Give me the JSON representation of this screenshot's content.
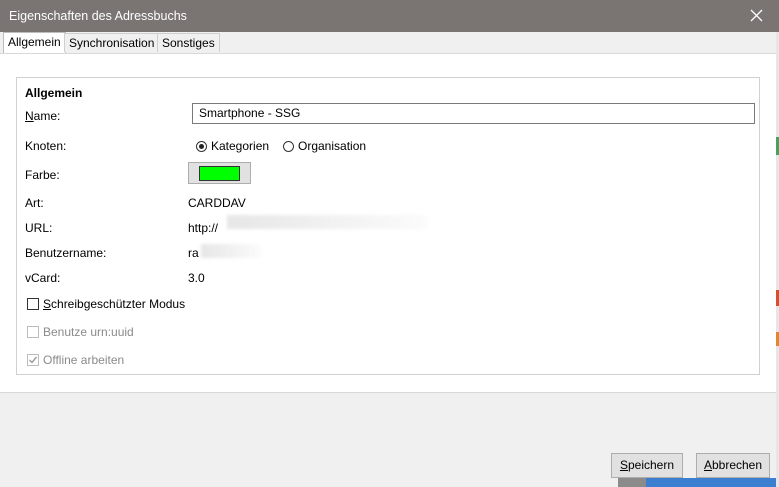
{
  "window": {
    "title": "Eigenschaften des Adressbuchs"
  },
  "tabs": [
    {
      "label": "Allgemein",
      "active": true
    },
    {
      "label": "Synchronisation",
      "active": false
    },
    {
      "label": "Sonstiges",
      "active": false
    }
  ],
  "group": {
    "title": "Allgemein",
    "name": {
      "label_accel": "N",
      "label_rest": "ame:",
      "value": "Smartphone - SSG"
    },
    "knoten": {
      "label": "Knoten:",
      "options": [
        {
          "label": "Kategorien",
          "selected": true
        },
        {
          "label": "Organisation",
          "selected": false
        }
      ]
    },
    "farbe": {
      "label": "Farbe:",
      "color": "#00ff00"
    },
    "art": {
      "label": "Art:",
      "value": "CARDDAV"
    },
    "url": {
      "label": "URL:",
      "value": "http://"
    },
    "benutzername": {
      "label": "Benutzername:",
      "value": "ra"
    },
    "vcard": {
      "label": "vCard:",
      "value": "3.0"
    },
    "checkboxes": [
      {
        "accel": "S",
        "rest": "chreibgeschützter Modus",
        "checked": false,
        "enabled": true
      },
      {
        "accel": "",
        "rest": "Benutze urn:uuid",
        "checked": false,
        "enabled": false
      },
      {
        "accel": "",
        "rest": "Offline arbeiten",
        "checked": true,
        "enabled": false
      }
    ]
  },
  "buttons": {
    "save_accel": "S",
    "save_rest": "peichern",
    "cancel_accel": "A",
    "cancel_rest": "bbrechen"
  },
  "colors": {
    "titlebar": "#7a7473",
    "swatch": "#00ff00"
  }
}
